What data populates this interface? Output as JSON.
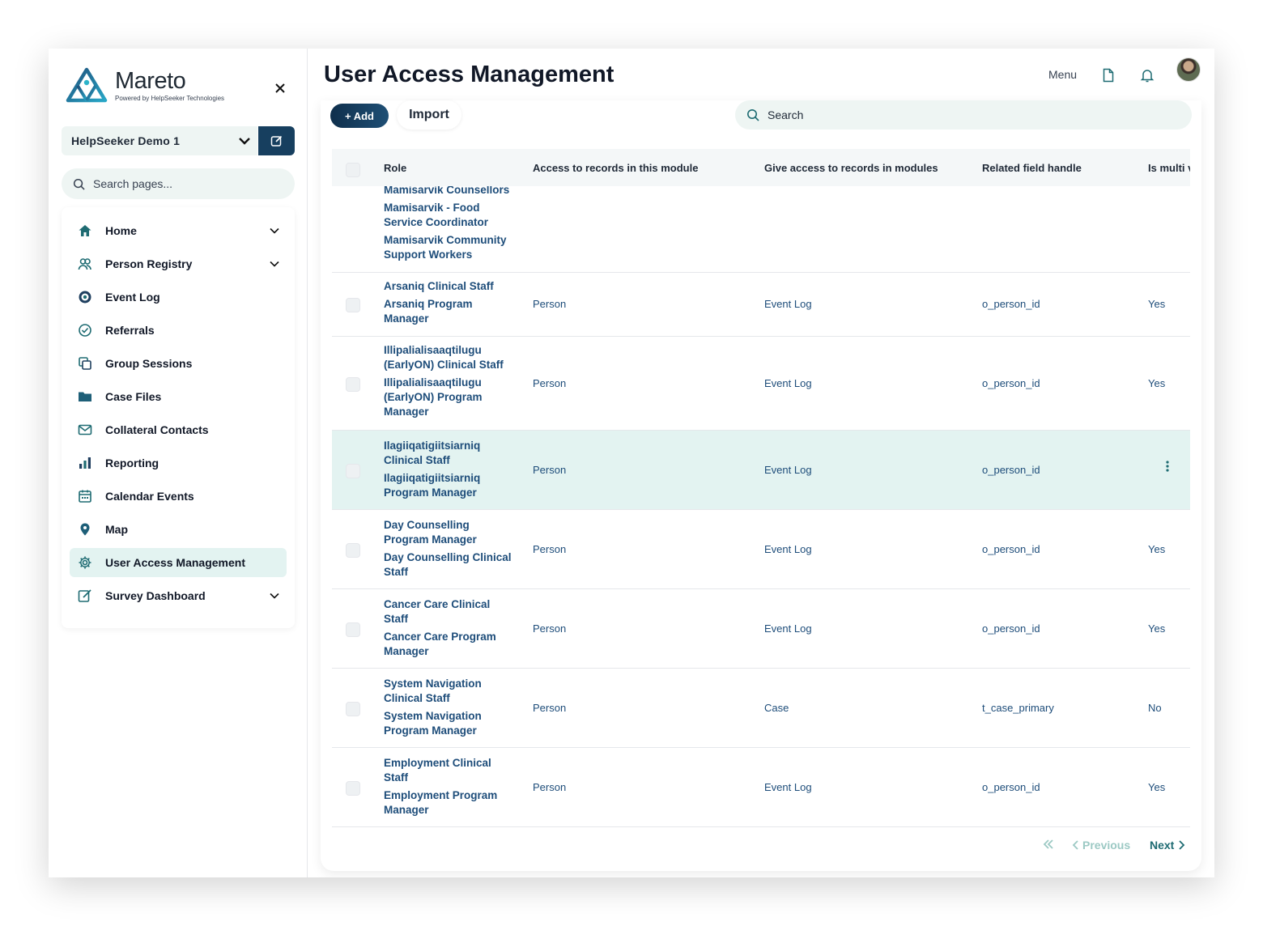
{
  "brand": {
    "name": "Mareto",
    "tagline": "Powered by HelpSeeker Technologies"
  },
  "sidebar": {
    "org": "HelpSeeker Demo 1",
    "search_placeholder": "Search pages...",
    "items": [
      {
        "label": "Home",
        "icon": "home-icon",
        "chevron": true
      },
      {
        "label": "Person Registry",
        "icon": "people-icon",
        "chevron": true
      },
      {
        "label": "Event Log",
        "icon": "target-icon",
        "chevron": false
      },
      {
        "label": "Referrals",
        "icon": "check-circle-icon",
        "chevron": false
      },
      {
        "label": "Group Sessions",
        "icon": "copy-icon",
        "chevron": false
      },
      {
        "label": "Case Files",
        "icon": "folder-icon",
        "chevron": false
      },
      {
        "label": "Collateral Contacts",
        "icon": "mail-icon",
        "chevron": false
      },
      {
        "label": "Reporting",
        "icon": "bar-chart-icon",
        "chevron": false
      },
      {
        "label": "Calendar Events",
        "icon": "calendar-icon",
        "chevron": false
      },
      {
        "label": "Map",
        "icon": "map-pin-icon",
        "chevron": false
      },
      {
        "label": "User Access Management",
        "icon": "settings-icon",
        "chevron": false,
        "active": true
      },
      {
        "label": "Survey Dashboard",
        "icon": "edit-icon",
        "chevron": true
      }
    ]
  },
  "header": {
    "title": "User Access Management",
    "menu": "Menu"
  },
  "toolbar": {
    "add": "+ Add",
    "import": "Import",
    "search_placeholder": "Search"
  },
  "table": {
    "columns": [
      "Role",
      "Access to records in this module",
      "Give access to records in modules",
      "Related field handle",
      "Is multi v"
    ],
    "rows": [
      {
        "roles": [
          "Mamisarvik Counsellors",
          "Mamisarvik - Food Service Coordinator",
          "Mamisarvik Community Support Workers"
        ],
        "access": "",
        "give": "",
        "handle": "",
        "multi": ""
      },
      {
        "roles": [
          "Arsaniq Clinical Staff",
          "Arsaniq Program Manager"
        ],
        "access": "Person",
        "give": "Event Log",
        "handle": "o_person_id",
        "multi": "Yes"
      },
      {
        "roles": [
          "Illipalialisaaqtilugu (EarlyON) Clinical Staff",
          "Illipalialisaaqtilugu (EarlyON) Program Manager"
        ],
        "access": "Person",
        "give": "Event Log",
        "handle": "o_person_id",
        "multi": "Yes"
      },
      {
        "roles": [
          "Ilagiiqatigiitsiarniq Clinical Staff",
          "Ilagiiqatigiitsiarniq Program Manager"
        ],
        "access": "Person",
        "give": "Event Log",
        "handle": "o_person_id",
        "multi": "",
        "highlighted": true
      },
      {
        "roles": [
          "Day Counselling Program Manager",
          "Day Counselling Clinical Staff"
        ],
        "access": "Person",
        "give": "Event Log",
        "handle": "o_person_id",
        "multi": "Yes"
      },
      {
        "roles": [
          "Cancer Care Clinical Staff",
          "Cancer Care Program Manager"
        ],
        "access": "Person",
        "give": "Event Log",
        "handle": "o_person_id",
        "multi": "Yes"
      },
      {
        "roles": [
          "System Navigation Clinical Staff",
          "System Navigation Program Manager"
        ],
        "access": "Person",
        "give": "Case",
        "handle": "t_case_primary",
        "multi": "No"
      },
      {
        "roles": [
          "Employment Clinical Staff",
          "Employment Program Manager"
        ],
        "access": "Person",
        "give": "Event Log",
        "handle": "o_person_id",
        "multi": "Yes"
      }
    ]
  },
  "pagination": {
    "previous": "Previous",
    "next": "Next"
  },
  "colors": {
    "primary": "#173f5f",
    "accent": "#1e6b72",
    "highlight": "#e3f3f1",
    "link": "#1e4d7a"
  }
}
